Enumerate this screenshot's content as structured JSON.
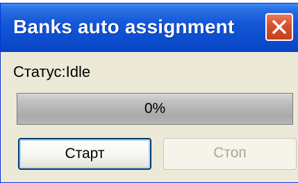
{
  "window": {
    "title": "Banks auto assignment",
    "close_icon": "close-icon"
  },
  "status": {
    "label": "Статус:Idle"
  },
  "progress": {
    "text": "0%",
    "value_percent": 0
  },
  "buttons": {
    "start_label": "Старт",
    "stop_label": "Стоп",
    "stop_enabled": false
  },
  "colors": {
    "titlebar": "#0d4fd0",
    "close_button": "#d5502b",
    "window_background": "#ece9d8"
  }
}
